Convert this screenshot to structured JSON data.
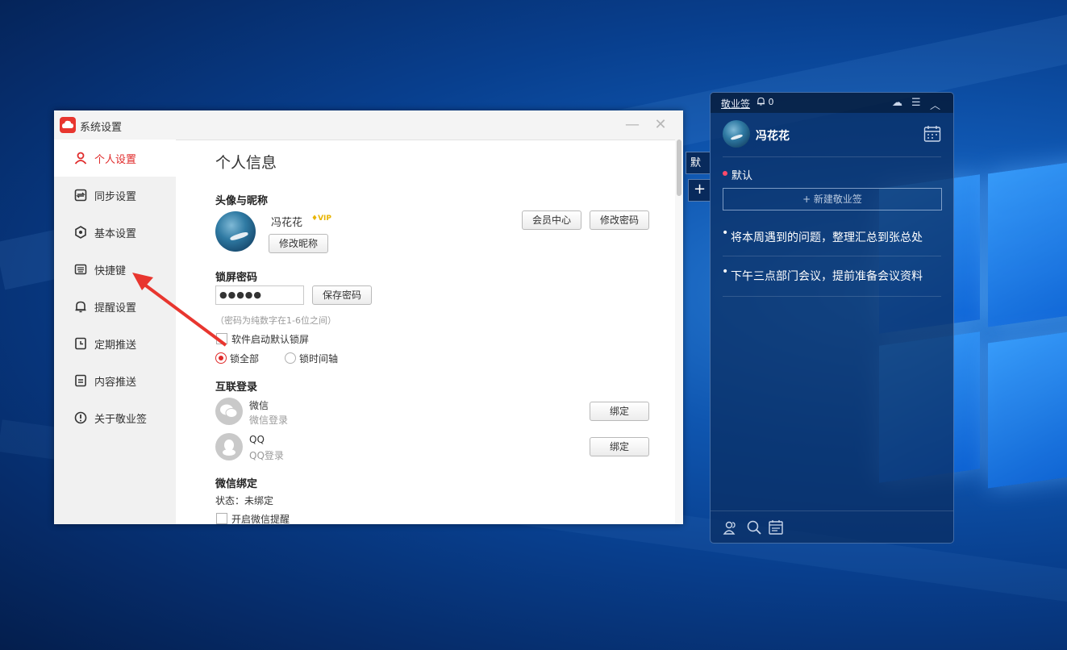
{
  "settings_window": {
    "title": "系统设置",
    "sidebar": [
      {
        "label": "个人设置",
        "icon": "user-icon",
        "active": true
      },
      {
        "label": "同步设置",
        "icon": "sync-icon"
      },
      {
        "label": "基本设置",
        "icon": "hexagon-settings-icon"
      },
      {
        "label": "快捷键",
        "icon": "keyboard-icon"
      },
      {
        "label": "提醒设置",
        "icon": "bell-icon"
      },
      {
        "label": "定期推送",
        "icon": "clock-doc-icon"
      },
      {
        "label": "内容推送",
        "icon": "document-icon"
      },
      {
        "label": "关于敬业签",
        "icon": "info-icon"
      }
    ],
    "page_title": "个人信息",
    "avatar_section": {
      "heading": "头像与昵称",
      "nickname": "冯花花",
      "vip_badge": "VIP",
      "edit_nickname_button": "修改昵称",
      "member_center_button": "会员中心",
      "change_password_button": "修改密码"
    },
    "lock_section": {
      "heading": "锁屏密码",
      "password_value": "●●●●●",
      "save_button": "保存密码",
      "hint": "（密码为纯数字在1-6位之间）",
      "auto_lock_checkbox_label": "软件启动默认锁屏",
      "radio_lock_all": "锁全部",
      "radio_lock_timeline": "锁时间轴"
    },
    "login_section": {
      "heading": "互联登录",
      "wechat_name": "微信",
      "wechat_sub": "微信登录",
      "qq_name": "QQ",
      "qq_sub": "QQ登录",
      "bind_button": "绑定"
    },
    "wechat_bind_section": {
      "heading": "微信绑定",
      "status": "状态：未绑定",
      "reminder_checkbox_label": "开启微信提醒"
    }
  },
  "widget": {
    "title": "敬业签",
    "bell_count": "0",
    "user_name": "冯花花",
    "side_tab": "默认",
    "side_add": "+",
    "category": "默认",
    "new_button": "+ 新建敬业签",
    "notes": [
      "将本周遇到的问题，整理汇总到张总处",
      "下午三点部门会议，提前准备会议资料"
    ]
  },
  "colors": {
    "accent": "#e02b2b",
    "widget_bg": "#0a2d5f"
  }
}
